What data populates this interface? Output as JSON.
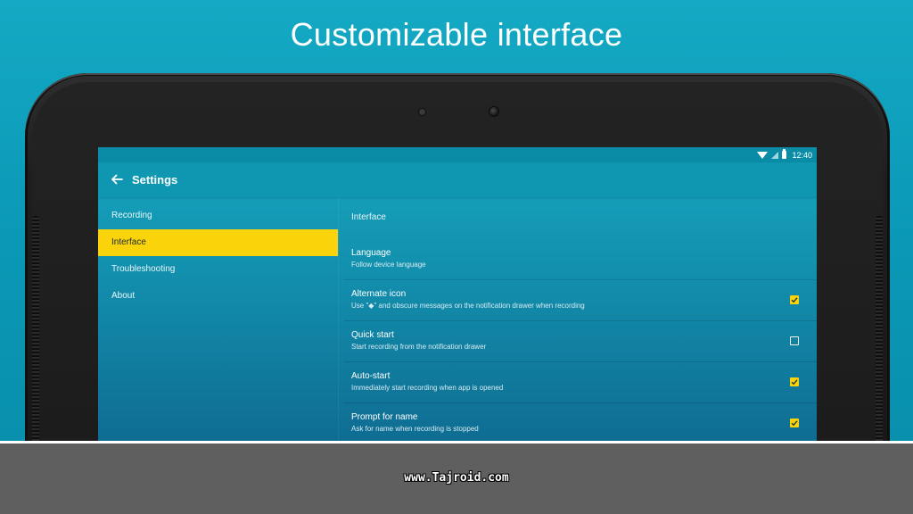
{
  "promo": {
    "title": "Customizable interface"
  },
  "status_bar": {
    "time": "12:40"
  },
  "toolbar": {
    "title": "Settings"
  },
  "nav": {
    "items": [
      {
        "label": "Recording",
        "active": false
      },
      {
        "label": "Interface",
        "active": true
      },
      {
        "label": "Troubleshooting",
        "active": false
      },
      {
        "label": "About",
        "active": false
      }
    ]
  },
  "content": {
    "section_header": "Interface",
    "prefs": [
      {
        "title": "Language",
        "summary": "Follow device language",
        "checkbox": null
      },
      {
        "title": "Alternate icon",
        "summary": "Use \"◆\" and obscure messages on the notification drawer when recording",
        "checkbox": true
      },
      {
        "title": "Quick start",
        "summary": "Start recording from the notification drawer",
        "checkbox": false
      },
      {
        "title": "Auto-start",
        "summary": "Immediately start recording when app is opened",
        "checkbox": true
      },
      {
        "title": "Prompt for name",
        "summary": "Ask for name when recording is stopped",
        "checkbox": true
      }
    ]
  },
  "footer": {
    "watermark": "www.Tajroid.com"
  },
  "colors": {
    "accent": "#fbd30a",
    "primary": "#0f97b1",
    "footer": "#5f5f5f"
  }
}
